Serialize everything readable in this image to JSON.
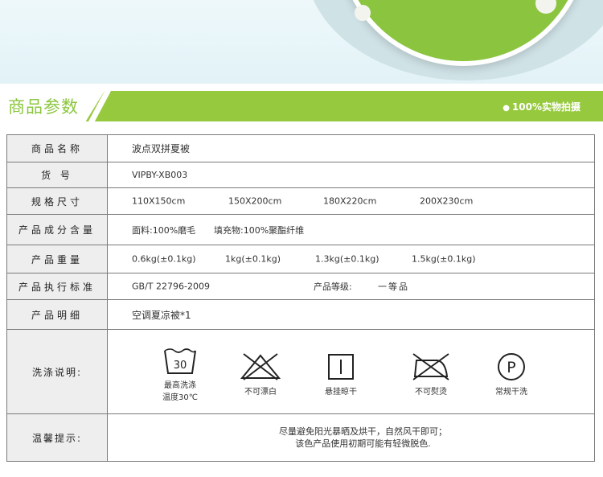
{
  "banner": {
    "title": "商品参数",
    "note": "100%实物拍摄",
    "bullet": "●"
  },
  "rows": {
    "name": {
      "label": "商品名称",
      "value": "波点双拼夏被"
    },
    "sku": {
      "label": "货 号",
      "value": "VIPBY-XB003"
    },
    "size": {
      "label": "规格尺寸",
      "values": [
        "110X150cm",
        "150X200cm",
        "180X220cm",
        "200X230cm"
      ]
    },
    "composition": {
      "label": "产品成分含量",
      "values": [
        "面料:100%磨毛",
        "填充物:100%聚酯纤维"
      ]
    },
    "weight": {
      "label": "产品重量",
      "values": [
        "0.6kg(±0.1kg)",
        "1kg(±0.1kg)",
        "1.3kg(±0.1kg)",
        "1.5kg(±0.1kg)"
      ]
    },
    "standard": {
      "label": "产品执行标准",
      "value": "GB/T 22796-2009",
      "grade_label": "产品等级:",
      "grade_value": "一等品"
    },
    "detail": {
      "label": "产品明细",
      "value": "空调夏凉被*1"
    },
    "wash": {
      "label": "洗涤说明:",
      "items": [
        {
          "icon": "wash-30-icon",
          "number": "30",
          "line1": "最高洗涤",
          "line2": "温度30℃"
        },
        {
          "icon": "no-bleach-icon",
          "line1": "不可漂白"
        },
        {
          "icon": "hang-dry-icon",
          "line1": "悬挂晾干"
        },
        {
          "icon": "no-iron-icon",
          "line1": "不可熨烫"
        },
        {
          "icon": "dry-clean-p-icon",
          "letter": "P",
          "line1": "常规干洗"
        }
      ]
    },
    "tips": {
      "label": "温馨提示:",
      "lines": [
        "尽量避免阳光暴晒及烘干，自然风干即可；",
        "该色产品使用初期可能有轻微脱色."
      ]
    }
  },
  "colors": {
    "accent": "#96c93d",
    "label_bg": "#eeeeee",
    "border": "#7a7a7a"
  }
}
